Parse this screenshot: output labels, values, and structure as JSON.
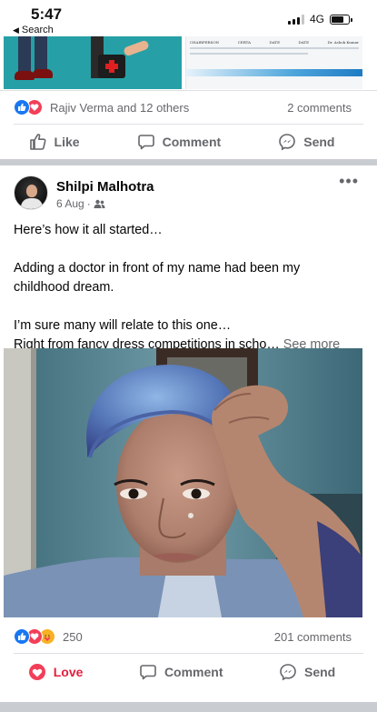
{
  "status_bar": {
    "time": "5:47",
    "back_label": "Search",
    "network": "4G"
  },
  "previous_post": {
    "reactions_text": "Rajiv Verma and 12 others",
    "comments_text": "2 comments",
    "actions": {
      "like": "Like",
      "comment": "Comment",
      "send": "Send"
    },
    "table_header": [
      "CHAIRPERSON",
      "CERTA",
      "DATE",
      "DATE",
      "Dr. Ashok Kumar"
    ]
  },
  "post": {
    "author": "Shilpi Malhotra",
    "date": "6 Aug",
    "audience_icon": "friends-icon",
    "text_lines": [
      "Here’s how it all started…",
      "",
      "Adding a doctor in front of my name had been my",
      "childhood dream.",
      "",
      "I’m sure many will relate to this one…"
    ],
    "last_line": "Right from fancy dress competitions in scho…",
    "see_more": "See more",
    "reaction_count": "250",
    "comments_text": "201 comments",
    "actions": {
      "love": "Love",
      "comment": "Comment",
      "send": "Send"
    }
  },
  "colors": {
    "like_blue": "#1877f2",
    "love_red": "#f33e58",
    "care_yellow": "#f7b125",
    "separator": "#c9ccd1",
    "meta_gray": "#65676b"
  }
}
